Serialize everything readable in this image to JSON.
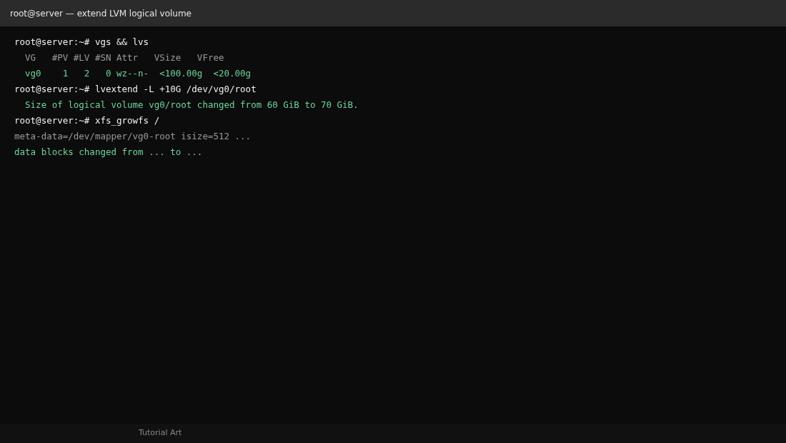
{
  "window": {
    "title": "root@server — extend LVM logical volume"
  },
  "lines": [
    {
      "kind": "prompt",
      "text": "root@server:~# vgs && lvs"
    },
    {
      "kind": "header",
      "text": "  VG   #PV #LV #SN Attr   VSize   VFree"
    },
    {
      "kind": "output",
      "text": "  vg0    1   2   0 wz--n-  <100.00g  <20.00g"
    },
    {
      "kind": "prompt",
      "text": "root@server:~# lvextend -L +10G /dev/vg0/root"
    },
    {
      "kind": "output",
      "text": "  Size of logical volume vg0/root changed from 60 GiB to 70 GiB."
    },
    {
      "kind": "prompt",
      "text": "root@server:~# xfs_growfs /"
    },
    {
      "kind": "header",
      "text": "meta-data=/dev/mapper/vg0-root isize=512 ..."
    },
    {
      "kind": "output",
      "text": "data blocks changed from ... to ..."
    }
  ],
  "status_bar": {
    "text": "Tutorial Art"
  }
}
